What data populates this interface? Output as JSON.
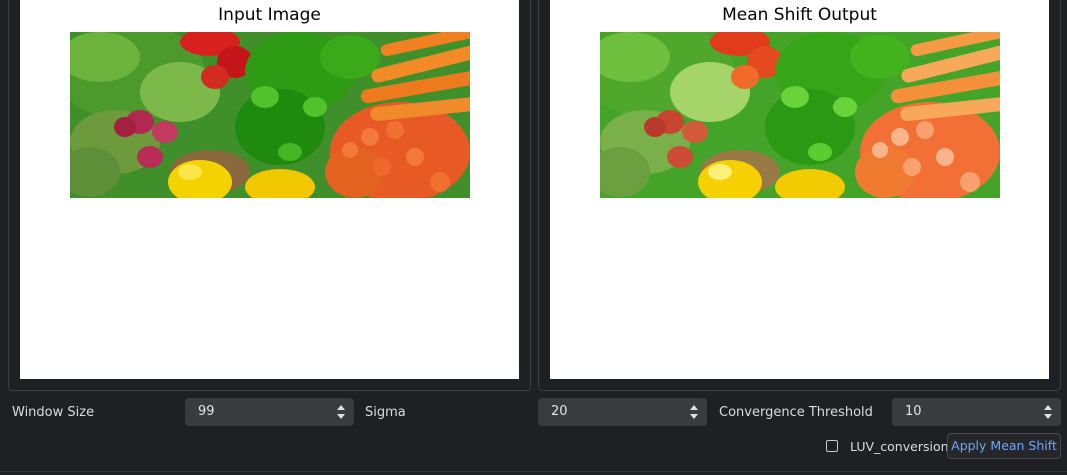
{
  "left_panel": {
    "title": "Input Image"
  },
  "right_panel": {
    "title": "Mean Shift Output"
  },
  "controls": {
    "window_size": {
      "label": "Window Size",
      "value": "99"
    },
    "sigma": {
      "label": "Sigma",
      "value": "20"
    },
    "convergence_threshold": {
      "label": "Convergence Threshold",
      "value": "10"
    },
    "luv_conversion": {
      "label": "LUV_conversion",
      "checked": false
    },
    "apply_button": {
      "label": "Apply Mean Shift"
    }
  },
  "colors": {
    "background": "#1f2024",
    "accent_text": "#6fa6f6",
    "spinbox": "#3a3b3f"
  }
}
